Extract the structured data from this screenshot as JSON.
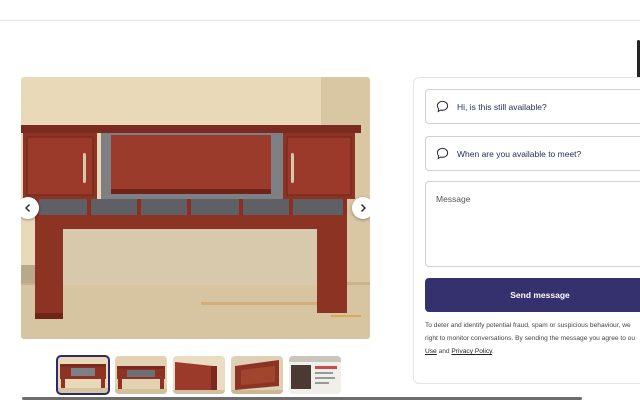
{
  "header": {
    "fragment": ""
  },
  "listing": {
    "thumbnails": [
      {
        "alt": "hutch-front"
      },
      {
        "alt": "hutch-angle"
      },
      {
        "alt": "hutch-side"
      },
      {
        "alt": "hutch-underside"
      },
      {
        "alt": "label-sticker"
      }
    ],
    "active_index": 0
  },
  "contact": {
    "quick_replies": [
      "Hi, is this still available?",
      "When are you available to meet?"
    ],
    "message_placeholder": "Message",
    "send_label": "Send message",
    "disclaimer": {
      "line1": "To deter and identify potential fraud, spam or suspicious behaviour, we",
      "line2": "right to monitor conversations. By sending the message you agree to ou",
      "link_use": "Use",
      "and_text": " and ",
      "link_privacy": "Privacy Policy",
      "end": "."
    }
  },
  "colors": {
    "accent": "#35306e",
    "wood": "#8a2f22",
    "wall": "#ead8b9"
  }
}
